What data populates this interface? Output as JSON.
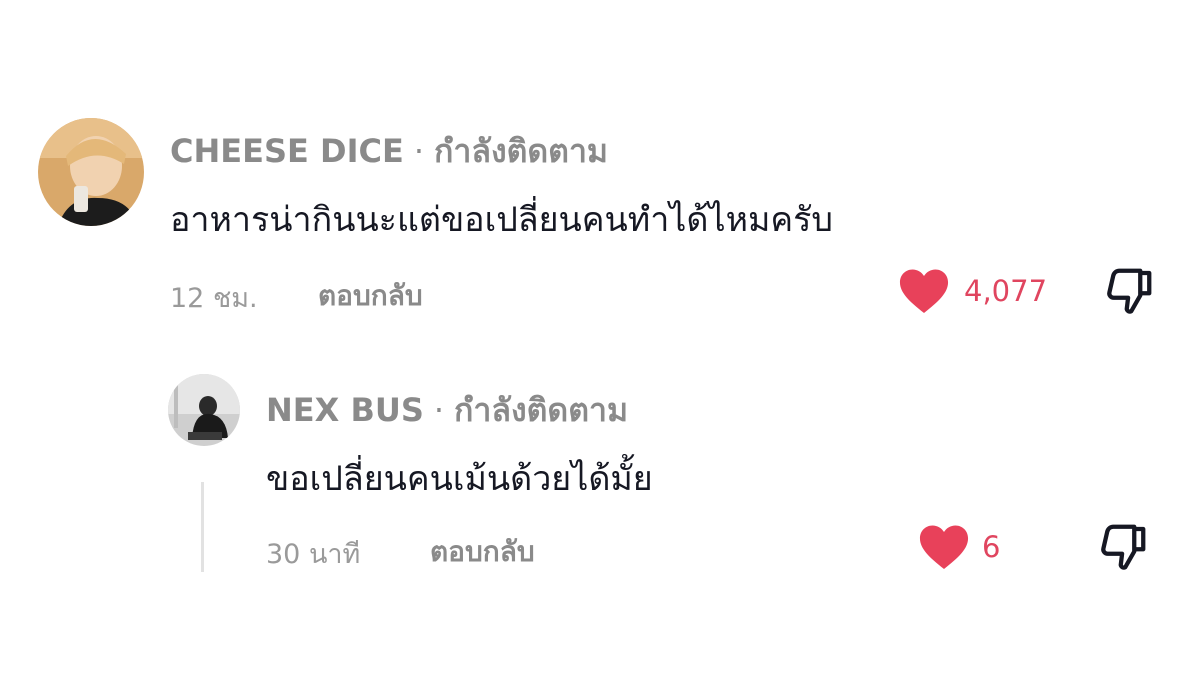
{
  "comments": [
    {
      "username": "CHEESE DICE",
      "separator": "·",
      "follow_status": "กำลังติดตาม",
      "text": "อาหารน่ากินนะแต่ขอเปลี่ยนคนทำได้ไหมครับ",
      "time": "12 ชม.",
      "reply_label": "ตอบกลับ",
      "likes": "4,077"
    },
    {
      "username": "NEX BUS",
      "separator": "·",
      "follow_status": "กำลังติดตาม",
      "text": "ขอเปลี่ยนคนเม้นด้วยได้มั้ย",
      "time": "30 นาที",
      "reply_label": "ตอบกลับ",
      "likes": "6"
    }
  ],
  "colors": {
    "like": "#e0455f",
    "meta": "#8a8a8a",
    "text": "#161823",
    "thread_line": "#e2e2e2"
  },
  "icons": [
    "heart-icon",
    "thumbs-down-icon"
  ]
}
